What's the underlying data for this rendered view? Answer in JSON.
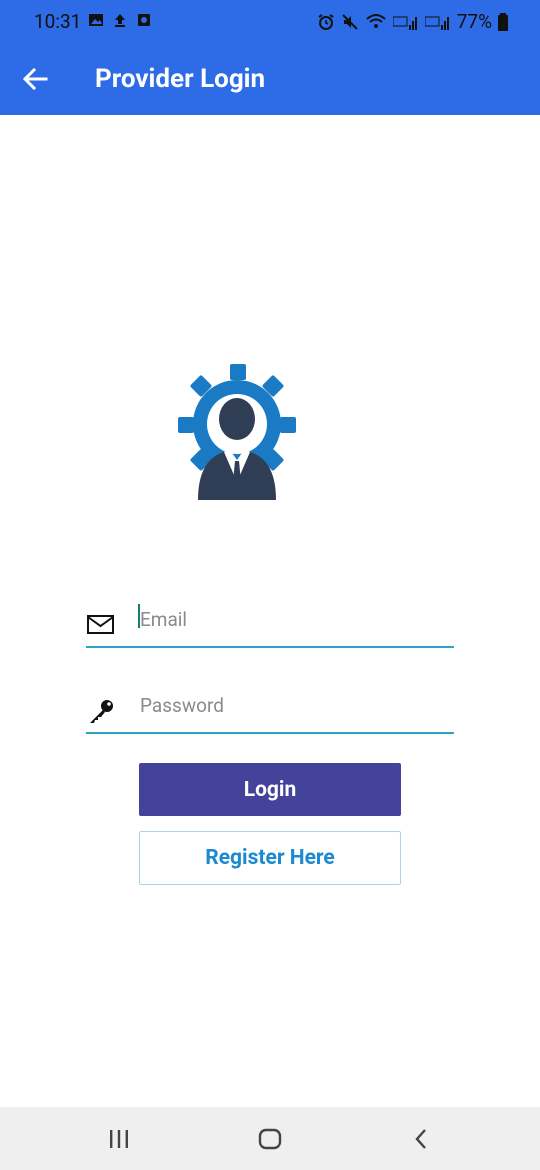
{
  "status_bar": {
    "time": "10:31",
    "battery": "77%"
  },
  "appbar": {
    "title": "Provider Login"
  },
  "form": {
    "email_placeholder": "Email",
    "email_value": "",
    "password_placeholder": "Password",
    "password_value": "",
    "login_label": "Login",
    "register_label": "Register Here"
  },
  "colors": {
    "primary": "#2e6be6",
    "login_button": "#43439b",
    "register_text": "#1c8ad1",
    "field_underline": "#2ea2c6"
  },
  "icons": {
    "back": "arrow-left-icon",
    "email": "envelope-icon",
    "password": "key-icon",
    "logo": "user-gear-icon",
    "nav_recents": "recents-icon",
    "nav_home": "home-icon",
    "nav_back": "chevron-left-icon"
  }
}
